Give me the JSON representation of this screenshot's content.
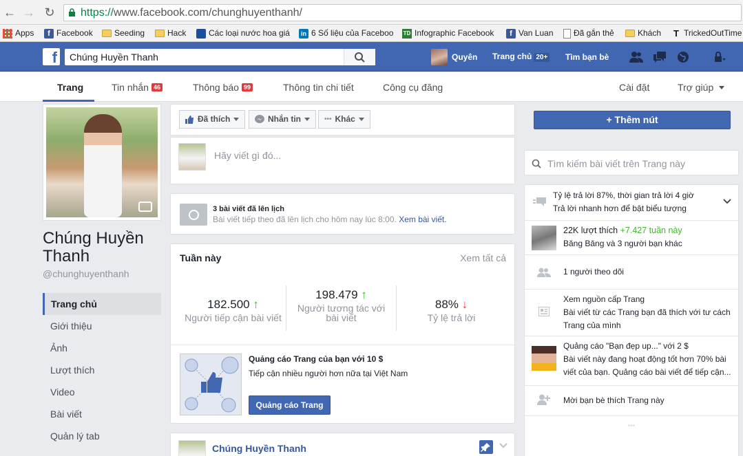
{
  "browser": {
    "url_scheme": "https://",
    "url_rest": "www.facebook.com/chunghuyenthanh/",
    "bookmarks": [
      "Apps",
      "Facebook",
      "Seeding",
      "Hack",
      "Các loại nước hoa giá",
      "6 Số liệu của Faceboo",
      "Infographic Facebook",
      "Van Luan",
      "Đã gắn thẻ",
      "Khách",
      "TrickedOutTime"
    ]
  },
  "fbbar": {
    "search_value": "Chúng Huyền Thanh",
    "user_name": "Quyên",
    "home_label": "Trang chủ",
    "home_count": "20+",
    "find_friends": "Tìm bạn bè"
  },
  "tabs": {
    "page": "Trang",
    "messages": "Tin nhắn",
    "messages_count": "46",
    "notifications": "Thông báo",
    "notifications_count": "99",
    "info": "Thông tin chi tiết",
    "publishing": "Công cụ đăng",
    "settings": "Cài đặt",
    "help": "Trợ giúp"
  },
  "profile": {
    "name": "Chúng Huyền Thanh",
    "handle": "@chunghuyenthanh"
  },
  "left_nav": [
    "Trang chủ",
    "Giới thiệu",
    "Ảnh",
    "Lượt thích",
    "Video",
    "Bài viết",
    "Quản lý tab"
  ],
  "actions": {
    "liked": "Đã thích",
    "message": "Nhắn tin",
    "more": "Khác",
    "add_button": "+ Thêm nút"
  },
  "composer": {
    "placeholder": "Hãy viết gì đó..."
  },
  "scheduled": {
    "title": "3 bài viết đã lên lịch",
    "text": "Bài viết tiếp theo đã lên lịch cho hôm nay lúc 8:00.",
    "link": "Xem bài viết."
  },
  "week": {
    "title": "Tuần này",
    "see_all": "Xem tất cả",
    "stats": [
      {
        "value": "182.500",
        "trend": "↑",
        "label": "Người tiếp cận bài viết"
      },
      {
        "value": "198.479",
        "trend": "↑",
        "label": "Người tương tác với bài viết"
      },
      {
        "value": "88%",
        "trend": "↓",
        "label": "Tỷ lệ trả lời"
      }
    ]
  },
  "promo": {
    "title": "Quảng cáo Trang của bạn với 10 $",
    "text": "Tiếp cận nhiều người hơn nữa tại Việt Nam",
    "button": "Quảng cáo Trang"
  },
  "post": {
    "author": "Chúng Huyền Thanh"
  },
  "right": {
    "search_placeholder": "Tìm kiếm bài viết trên Trang này",
    "response": {
      "title": "Tỷ lệ trả lời 87%, thời gian trả lời 4 giờ",
      "sub": "Trả lời nhanh hơn để bật biểu tượng"
    },
    "likes": {
      "count": "22K lượt thích",
      "delta": "+7.427 tuần này",
      "sub": "Băng Băng và 3 người bạn khác"
    },
    "followers": "1 người theo dõi",
    "feed": {
      "title": "Xem nguồn cấp Trang",
      "sub": "Bài viết từ các Trang bạn đã thích với tư cách Trang của mình"
    },
    "ad": {
      "title": "Quảng cáo \"Bạn đẹp up...\" với 2 $",
      "sub": "Bài viết này đang hoạt động tốt hơn 70% bài viết của bạn. Quảng cáo bài viết để tiếp cận..."
    },
    "invite": "Mời bạn bè thích Trang này",
    "more": "•••"
  }
}
